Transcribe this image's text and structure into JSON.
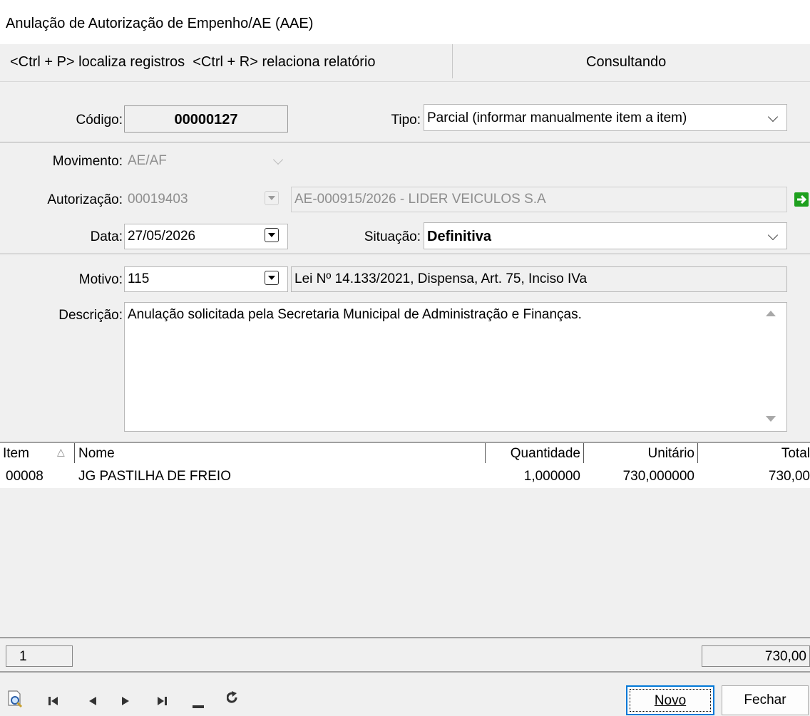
{
  "window": {
    "title": "Anulação de Autorização de Empenho/AE (AAE)"
  },
  "hint_bar": {
    "shortcuts": "<Ctrl + P> localiza registros  <Ctrl + R> relaciona relatório",
    "status": "Consultando"
  },
  "form": {
    "codigo": {
      "label": "Código:",
      "value": "00000127"
    },
    "tipo": {
      "label": "Tipo:",
      "value": "Parcial (informar manualmente item a item)"
    },
    "movimento": {
      "label": "Movimento:",
      "value": "AE/AF"
    },
    "autorizacao": {
      "label": "Autorização:",
      "value": "00019403",
      "description": "AE-000915/2026 - LIDER VEICULOS S.A"
    },
    "data": {
      "label": "Data:",
      "value": "27/05/2026"
    },
    "situacao": {
      "label": "Situação:",
      "value": "Definitiva"
    },
    "motivo": {
      "label": "Motivo:",
      "value": "115",
      "description": "Lei Nº 14.133/2021, Dispensa, Art. 75, Inciso IVa"
    },
    "descricao": {
      "label": "Descrição:",
      "value": "Anulação solicitada pela Secretaria Municipal de Administração e Finanças."
    }
  },
  "grid": {
    "columns": [
      "Item",
      "Nome",
      "Quantidade",
      "Unitário",
      "Total"
    ],
    "rows": [
      {
        "item": "00008",
        "nome": "JG PASTILHA DE FREIO",
        "quantidade": "1,000000",
        "unitario": "730,000000",
        "total": "730,00"
      }
    ]
  },
  "footer": {
    "count": "1",
    "total": "730,00"
  },
  "buttons": {
    "novo": "Novo",
    "fechar": "Fechar"
  },
  "colors": {
    "accent_arrow": "#1ea01e",
    "default_button_border": "#0078d7"
  }
}
